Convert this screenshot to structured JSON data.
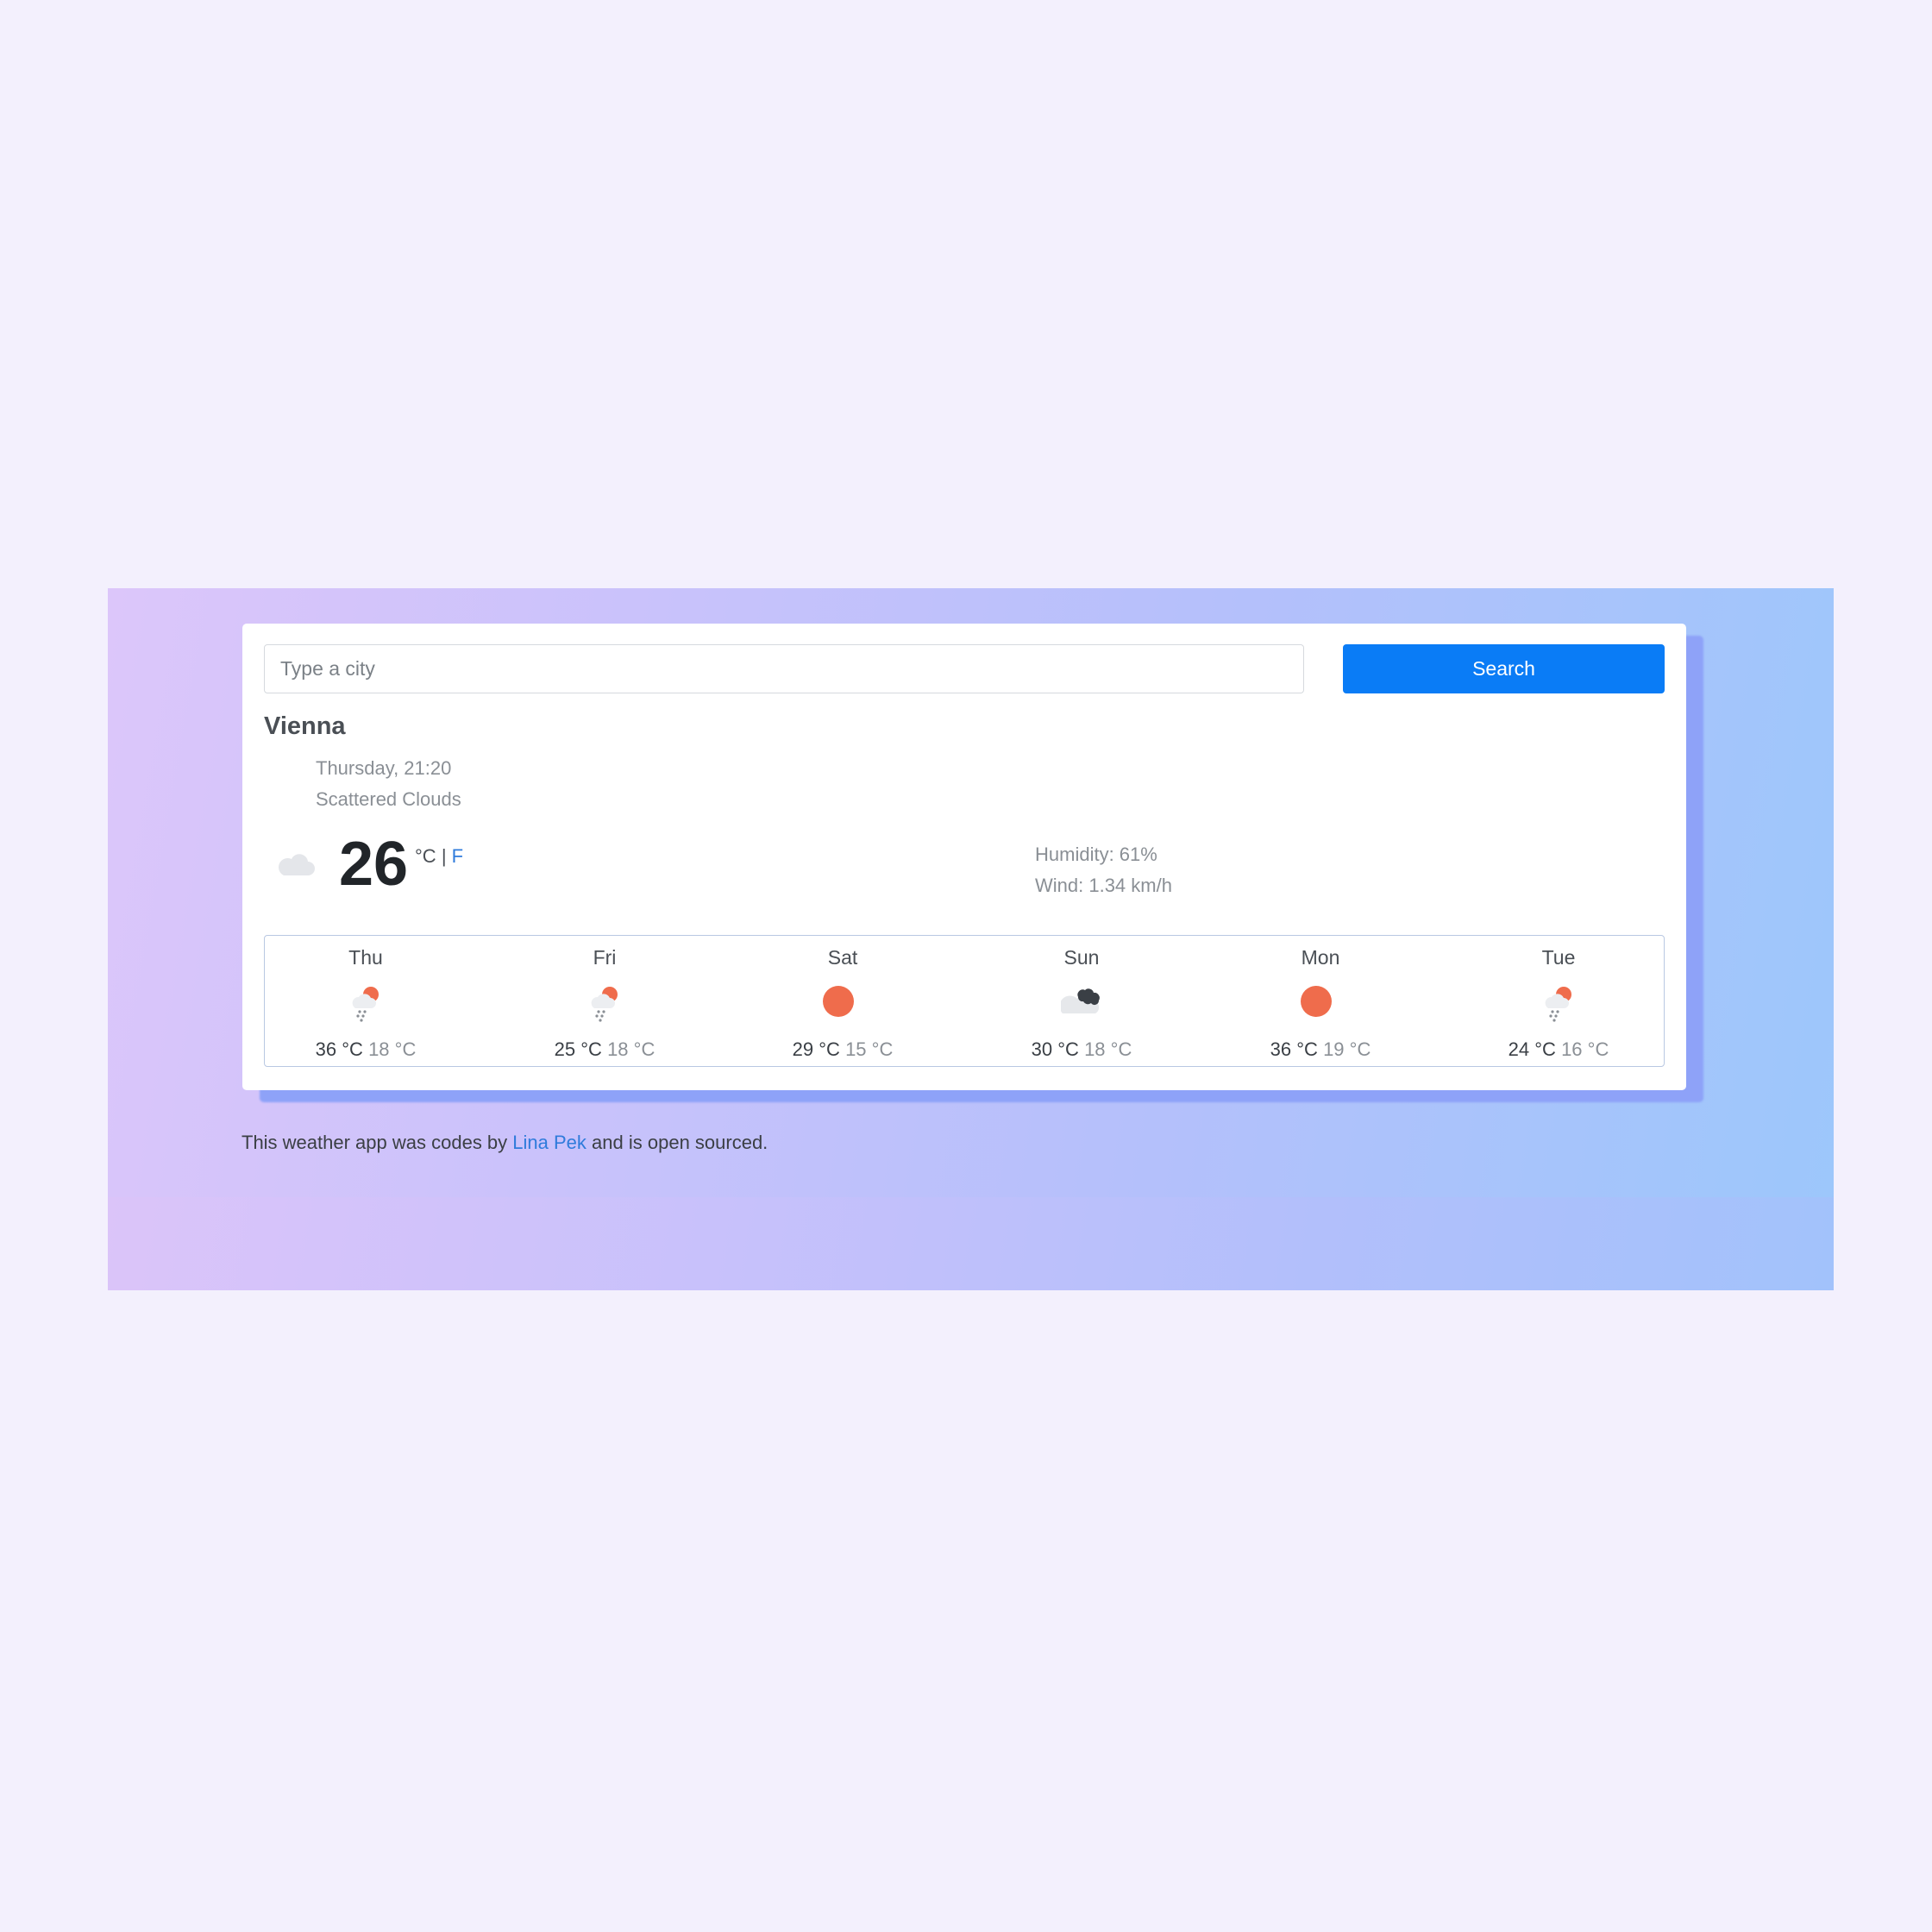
{
  "search": {
    "placeholder": "Type a city",
    "value": "",
    "button_label": "Search",
    "button_color": "#0a7cf6"
  },
  "current": {
    "city": "Vienna",
    "date": "Thursday, 21:20",
    "description": "Scattered Clouds",
    "icon": "cloud-icon",
    "temperature": "26",
    "unit_celsius": "°C",
    "unit_separator": "|",
    "unit_fahrenheit": "F",
    "humidity": "Humidity: 61%",
    "wind": "Wind: 1.34 km/h"
  },
  "forecast": [
    {
      "day": "Thu",
      "icon": "rain-sun-icon",
      "max": "36 °C",
      "min": "18 °C"
    },
    {
      "day": "Fri",
      "icon": "rain-sun-icon",
      "max": "25 °C",
      "min": "18 °C"
    },
    {
      "day": "Sat",
      "icon": "sun-icon",
      "max": "29 °C",
      "min": "15 °C"
    },
    {
      "day": "Sun",
      "icon": "broken-clouds-icon",
      "max": "30 °C",
      "min": "18 °C"
    },
    {
      "day": "Mon",
      "icon": "sun-icon",
      "max": "36 °C",
      "min": "19 °C"
    },
    {
      "day": "Tue",
      "icon": "rain-sun-icon",
      "max": "24 °C",
      "min": "16 °C"
    }
  ],
  "footer": {
    "text_before": "This weather app was codes by",
    "link_text": "Lina Pek",
    "text_after": "and is open sourced."
  },
  "colors": {
    "accent": "#0a7cf6",
    "link": "#2f7bdb",
    "sun": "#ef6c4c"
  }
}
